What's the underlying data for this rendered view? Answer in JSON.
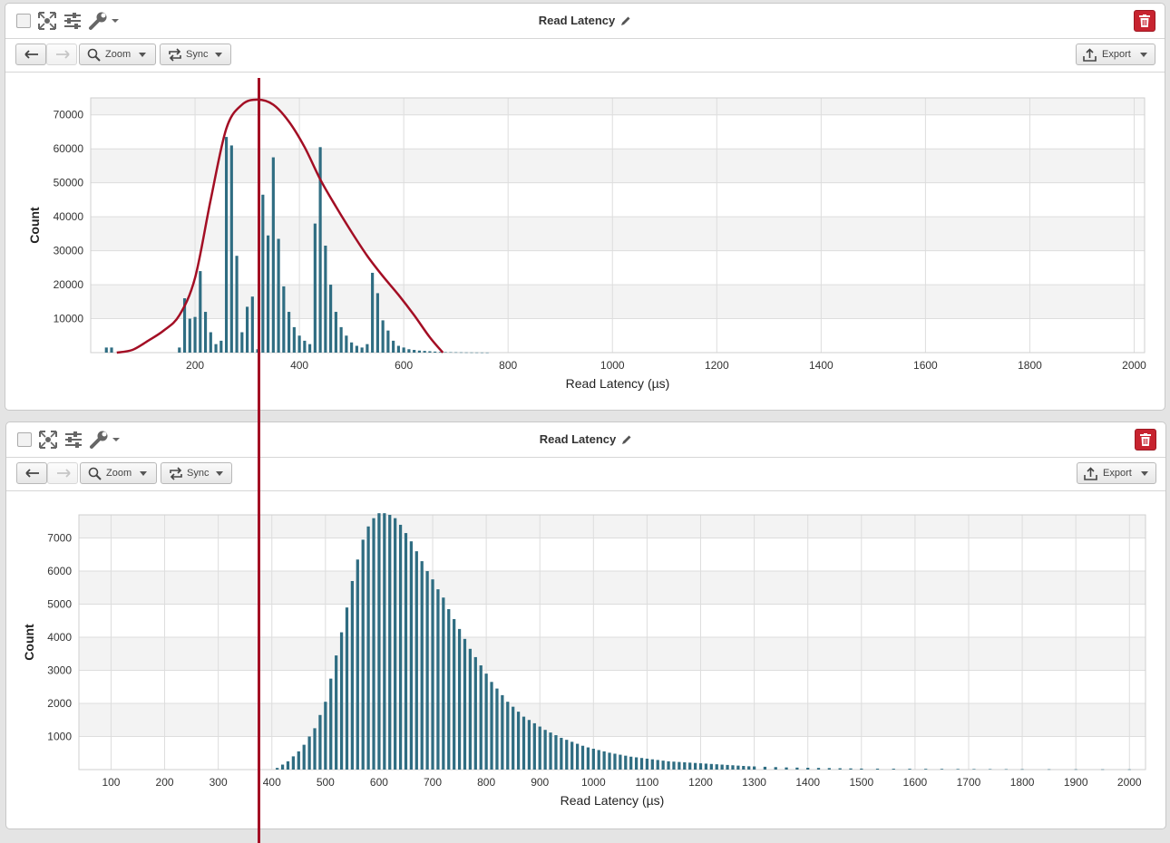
{
  "colors": {
    "bar": "#2f6d82",
    "curve": "#a30e24",
    "cursor": "#a30e24",
    "delete": "#c7232f"
  },
  "panels": [
    {
      "title": "Read Latency",
      "toolbar": {
        "zoom_label": "Zoom",
        "sync_label": "Sync",
        "export_label": "Export"
      },
      "icons": [
        "checkbox",
        "expand-icon",
        "sliders-icon",
        "wrench-icon",
        "pencil-icon",
        "trash-icon",
        "back-arrow-icon",
        "forward-arrow-icon",
        "search-icon",
        "sync-icon",
        "export-icon"
      ]
    },
    {
      "title": "Read Latency",
      "toolbar": {
        "zoom_label": "Zoom",
        "sync_label": "Sync",
        "export_label": "Export"
      },
      "icons": [
        "checkbox",
        "expand-icon",
        "sliders-icon",
        "wrench-icon",
        "pencil-icon",
        "trash-icon",
        "back-arrow-icon",
        "forward-arrow-icon",
        "search-icon",
        "sync-icon",
        "export-icon"
      ]
    }
  ],
  "chart_data": [
    {
      "type": "bar",
      "xlabel": "Read Latency (µs)",
      "ylabel": "Count",
      "xlim": [
        0,
        2020
      ],
      "ylim": [
        0,
        75000
      ],
      "xticks": [
        200,
        400,
        600,
        800,
        1000,
        1200,
        1400,
        1600,
        1800,
        2000
      ],
      "yticks": [
        10000,
        20000,
        30000,
        40000,
        50000,
        60000,
        70000
      ],
      "grid": true,
      "bin_width": 10,
      "x": [
        30,
        40,
        170,
        180,
        190,
        200,
        210,
        220,
        230,
        240,
        250,
        260,
        270,
        280,
        290,
        300,
        310,
        320,
        330,
        340,
        350,
        360,
        370,
        380,
        390,
        400,
        410,
        420,
        430,
        440,
        450,
        460,
        470,
        480,
        490,
        500,
        510,
        520,
        530,
        540,
        550,
        560,
        570,
        580,
        590,
        600,
        610,
        620,
        630,
        640,
        650,
        660,
        670,
        680,
        690,
        700,
        710,
        720,
        730,
        740,
        750,
        760
      ],
      "values": [
        1500,
        1500,
        1500,
        16000,
        10000,
        10500,
        24000,
        12000,
        6000,
        2500,
        3500,
        63500,
        61000,
        28500,
        6000,
        13500,
        16500,
        1000,
        46500,
        34500,
        57500,
        33500,
        19500,
        12000,
        7500,
        5000,
        3500,
        2500,
        38000,
        60500,
        31500,
        20000,
        12000,
        7500,
        5000,
        3000,
        2000,
        1500,
        2500,
        23500,
        17500,
        9500,
        6500,
        3500,
        2000,
        1500,
        1000,
        800,
        600,
        500,
        400,
        300,
        200,
        150,
        120,
        100,
        80,
        60,
        50,
        40,
        30,
        20
      ],
      "overlay_curve": {
        "x": [
          50,
          80,
          110,
          140,
          170,
          200,
          230,
          260,
          290,
          320,
          350,
          380,
          410,
          440,
          470,
          500,
          530,
          560,
          590,
          620,
          650,
          675
        ],
        "y": [
          0,
          800,
          3500,
          6500,
          11000,
          22000,
          45000,
          66000,
          73000,
          74500,
          73000,
          68000,
          60500,
          51000,
          43000,
          35500,
          28500,
          22500,
          17000,
          11000,
          4500,
          0
        ]
      }
    },
    {
      "type": "bar",
      "xlabel": "Read Latency (µs)",
      "ylabel": "Count",
      "xlim": [
        40,
        2030
      ],
      "ylim": [
        0,
        7700
      ],
      "xticks": [
        100,
        200,
        300,
        400,
        500,
        600,
        700,
        800,
        900,
        1000,
        1100,
        1200,
        1300,
        1400,
        1500,
        1600,
        1700,
        1800,
        1900,
        2000
      ],
      "yticks": [
        1000,
        2000,
        3000,
        4000,
        5000,
        6000,
        7000
      ],
      "grid": true,
      "bin_width": 10,
      "x": [
        410,
        420,
        430,
        440,
        450,
        460,
        470,
        480,
        490,
        500,
        510,
        520,
        530,
        540,
        550,
        560,
        570,
        580,
        590,
        600,
        610,
        620,
        630,
        640,
        650,
        660,
        670,
        680,
        690,
        700,
        710,
        720,
        730,
        740,
        750,
        760,
        770,
        780,
        790,
        800,
        810,
        820,
        830,
        840,
        850,
        860,
        870,
        880,
        890,
        900,
        910,
        920,
        930,
        940,
        950,
        960,
        970,
        980,
        990,
        1000,
        1010,
        1020,
        1030,
        1040,
        1050,
        1060,
        1070,
        1080,
        1090,
        1100,
        1110,
        1120,
        1130,
        1140,
        1150,
        1160,
        1170,
        1180,
        1190,
        1200,
        1210,
        1220,
        1230,
        1240,
        1250,
        1260,
        1270,
        1280,
        1290,
        1300,
        1320,
        1340,
        1360,
        1380,
        1400,
        1420,
        1440,
        1460,
        1480,
        1500,
        1530,
        1560,
        1590,
        1620,
        1650,
        1680,
        1710,
        1740,
        1770,
        1800,
        1850,
        1900,
        1950,
        2000
      ],
      "values": [
        50,
        150,
        250,
        400,
        550,
        750,
        1000,
        1250,
        1650,
        2050,
        2750,
        3450,
        4150,
        4900,
        5700,
        6350,
        6950,
        7350,
        7600,
        7750,
        7750,
        7700,
        7600,
        7400,
        7150,
        6900,
        6600,
        6300,
        6000,
        5750,
        5450,
        5200,
        4850,
        4550,
        4250,
        3950,
        3650,
        3400,
        3150,
        2900,
        2650,
        2450,
        2250,
        2050,
        1900,
        1750,
        1600,
        1500,
        1400,
        1300,
        1200,
        1120,
        1040,
        960,
        900,
        840,
        780,
        720,
        670,
        630,
        590,
        550,
        510,
        480,
        450,
        420,
        390,
        370,
        350,
        330,
        310,
        290,
        270,
        250,
        240,
        230,
        220,
        210,
        200,
        190,
        180,
        170,
        160,
        150,
        140,
        130,
        120,
        110,
        100,
        95,
        85,
        75,
        65,
        60,
        55,
        50,
        45,
        40,
        35,
        30,
        28,
        26,
        24,
        22,
        20,
        18,
        16,
        14,
        12,
        10,
        9,
        8,
        7,
        6
      ]
    }
  ]
}
